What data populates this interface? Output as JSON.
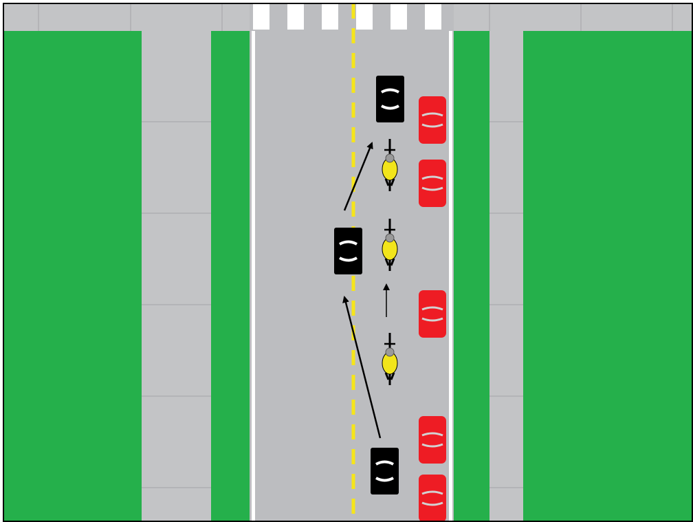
{
  "colors": {
    "grass": "#25b04b",
    "sidewalk": "#c3c4c6",
    "sidewalk_joint": "#aeafb2",
    "road": "#bcbdc0",
    "edge_line": "#ffffff",
    "center_line": "#f6e51a",
    "crosswalk": "#ffffff",
    "moving_car": "#000000",
    "parked_car": "#ee1c24",
    "cyclist_jersey": "#f2e51b",
    "arrow": "#000000",
    "frame": "#000000"
  },
  "scene": {
    "description_icons": [
      "moving-car-icon",
      "parked-car-icon",
      "cyclist-icon",
      "direction-arrow-icon",
      "crosswalk-icon"
    ],
    "moving_cars": 3,
    "parked_cars": 5,
    "cyclists": 3,
    "arrows": 3
  }
}
